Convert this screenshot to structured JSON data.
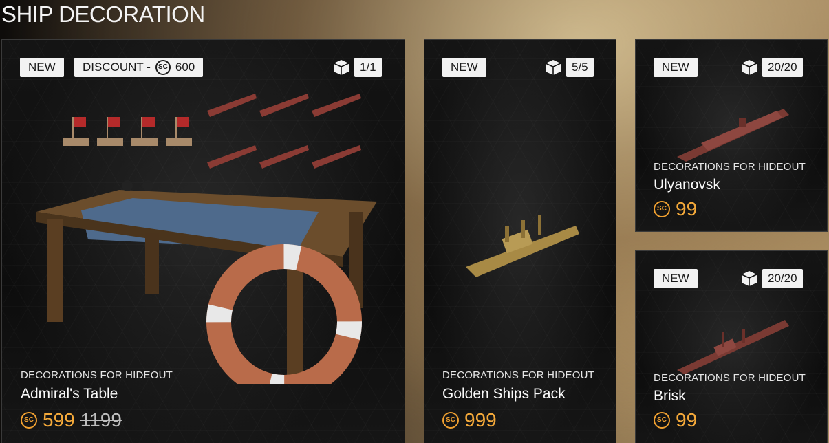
{
  "page": {
    "title": "SHIP DECORATION"
  },
  "currency": {
    "icon": "sc-coin-icon",
    "symbol": "SC",
    "color": "#f4a93a"
  },
  "cards": [
    {
      "badge_new": "NEW",
      "discount_label": "DISCOUNT -",
      "discount_amount": "600",
      "count": "1/1",
      "category": "DECORATIONS FOR HIDEOUT",
      "name": "Admiral's Table",
      "price": "599",
      "old_price": "1199"
    },
    {
      "badge_new": "NEW",
      "count": "5/5",
      "category": "DECORATIONS FOR HIDEOUT",
      "name": "Golden Ships Pack",
      "price": "999"
    },
    {
      "badge_new": "NEW",
      "count": "20/20",
      "category": "DECORATIONS FOR HIDEOUT",
      "name": "Ulyanovsk",
      "price": "99"
    },
    {
      "badge_new": "NEW",
      "count": "20/20",
      "category": "DECORATIONS FOR HIDEOUT",
      "name": "Brisk",
      "price": "99"
    }
  ]
}
